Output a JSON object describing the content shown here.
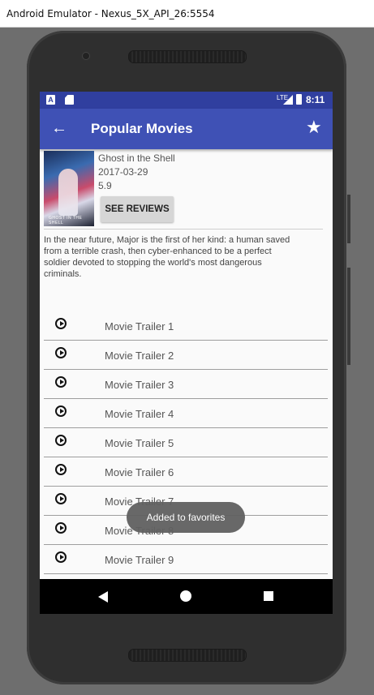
{
  "window": {
    "title": "Android Emulator - Nexus_5X_API_26:5554"
  },
  "status_bar": {
    "time": "8:11",
    "network": "LTE",
    "left_icons": [
      "a-icon",
      "sd-card-icon"
    ],
    "color": "#303f9f"
  },
  "app_bar": {
    "title": "Popular Movies",
    "back_icon": "arrow-back-icon",
    "favorite_icon": "star-icon",
    "color": "#3f51b5"
  },
  "movie": {
    "title": "Ghost in the Shell",
    "release_date": "2017-03-29",
    "rating": "5.9",
    "reviews_button": "SEE REVIEWS",
    "overview": "In the near future, Major is the first of her kind: a human saved from a terrible crash, then cyber-enhanced to be a perfect soldier devoted to stopping the world's most dangerous criminals."
  },
  "trailers": [
    "Movie Trailer 1",
    "Movie Trailer 2",
    "Movie Trailer 3",
    "Movie Trailer 4",
    "Movie Trailer 5",
    "Movie Trailer 6",
    "Movie Trailer 7",
    "Movie Trailer 8",
    "Movie Trailer 9"
  ],
  "toast": "Added to favorites",
  "nav_bar": {
    "back": "nav-back-icon",
    "home": "nav-home-icon",
    "recents": "nav-recents-icon"
  }
}
